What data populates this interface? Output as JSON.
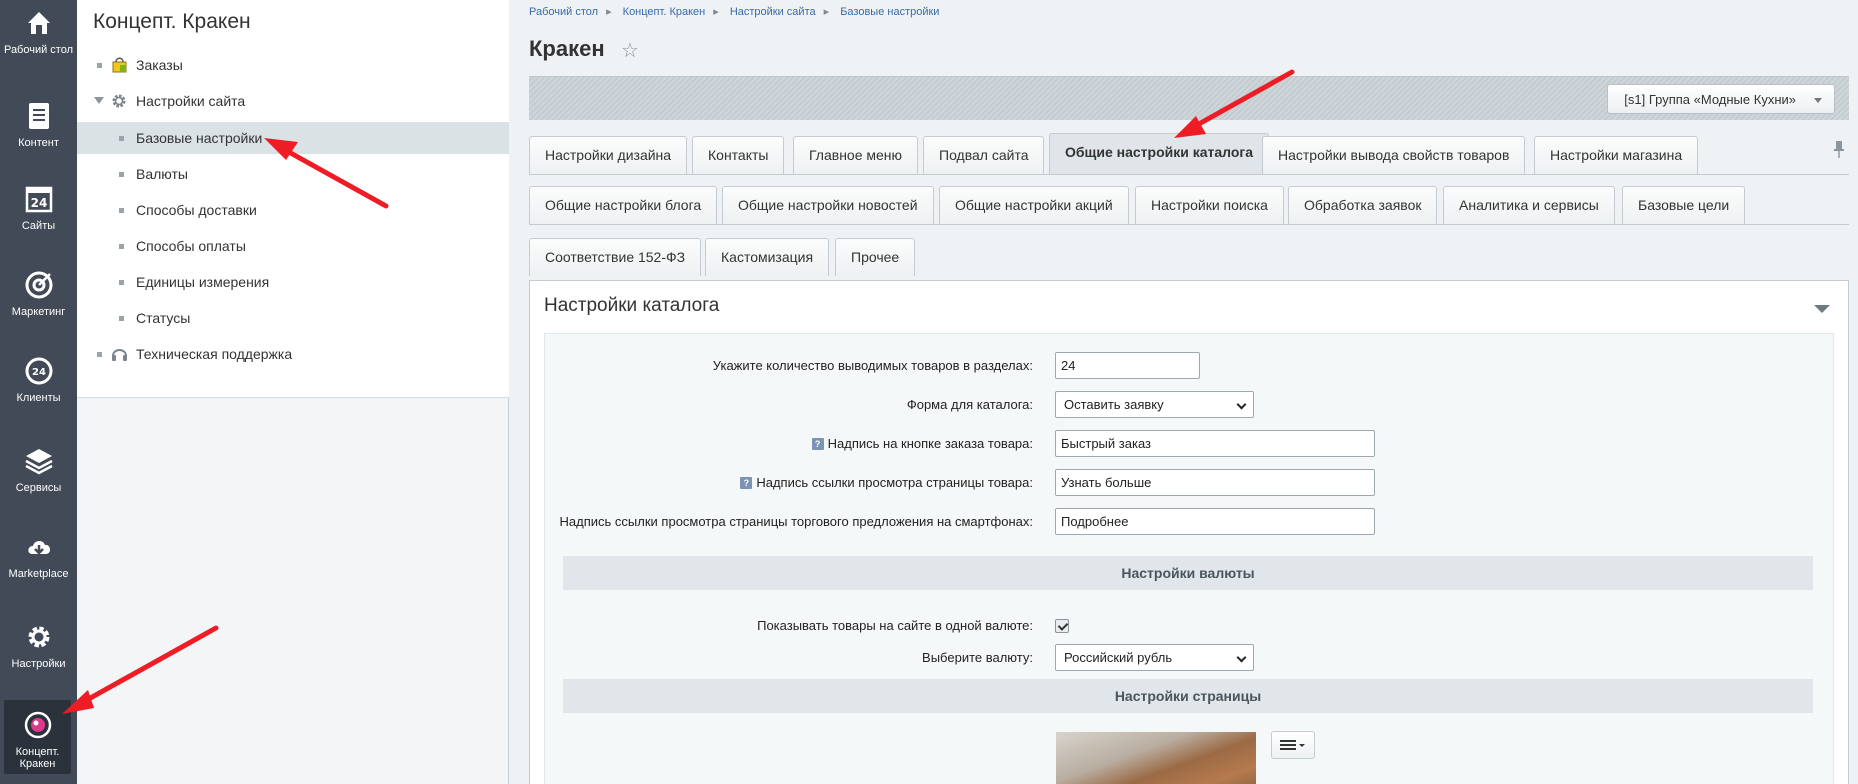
{
  "rail": [
    {
      "label": "Рабочий стол",
      "icon": "home-icon"
    },
    {
      "label": "Контент",
      "icon": "document-icon"
    },
    {
      "label": "Сайты",
      "icon": "calendar-24-icon"
    },
    {
      "label": "Маркетинг",
      "icon": "target-icon"
    },
    {
      "label": "Клиенты",
      "icon": "crm-24-icon"
    },
    {
      "label": "Сервисы",
      "icon": "layers-icon"
    },
    {
      "label": "Marketplace",
      "icon": "cloud-download-icon"
    },
    {
      "label": "Настройки",
      "icon": "gear-icon"
    },
    {
      "label": "Концепт. Кракен",
      "icon": "kraken-logo-icon"
    }
  ],
  "menu": {
    "title": "Концепт. Кракен",
    "items": [
      {
        "label": "Заказы",
        "icon": "shopping-bag-icon"
      },
      {
        "label": "Настройки сайта",
        "icon": "gear-icon"
      },
      {
        "label": "Базовые настройки"
      },
      {
        "label": "Валюты"
      },
      {
        "label": "Способы доставки"
      },
      {
        "label": "Способы оплаты"
      },
      {
        "label": "Единицы измерения"
      },
      {
        "label": "Статусы"
      },
      {
        "label": "Техническая поддержка",
        "icon": "headset-icon"
      }
    ]
  },
  "breadcrumbs": [
    "Рабочий стол",
    "Концепт. Кракен",
    "Настройки сайта",
    "Базовые настройки"
  ],
  "page_title": "Кракен",
  "site_selector": "[s1] Группа «Модные Кухни»",
  "tabs_row1": [
    "Настройки дизайна",
    "Контакты",
    "Главное меню",
    "Подвал сайта",
    "Общие настройки каталога",
    "Настройки вывода свойств товаров",
    "Настройки магазина"
  ],
  "tabs_row2": [
    "Общие настройки блога",
    "Общие настройки новостей",
    "Общие настройки акций",
    "Настройки поиска",
    "Обработка заявок",
    "Аналитика и сервисы",
    "Базовые цели"
  ],
  "tabs_row3": [
    "Соответствие 152-ФЗ",
    "Кастомизация",
    "Прочее"
  ],
  "active_tab": "Общие настройки каталога",
  "panel": {
    "title": "Настройки каталога",
    "fields": [
      {
        "label": "Укажите количество выводимых товаров в разделах:",
        "value": "24"
      },
      {
        "label": "Форма для каталога:",
        "value": "Оставить заявку"
      },
      {
        "label": "Надпись на кнопке заказа товара:",
        "value": "Быстрый заказ",
        "help": "?"
      },
      {
        "label": "Надпись ссылки просмотра страницы товара:",
        "value": "Узнать больше",
        "help": "?"
      },
      {
        "label": "Надпись ссылки просмотра страницы торгового предложения на смартфонах:",
        "value": "Подробнее"
      }
    ],
    "currency_section": "Настройки валюты",
    "currency_fields": [
      {
        "label": "Показывать товары на сайте в одной валюте:",
        "checked": true
      },
      {
        "label": "Выберите валюту:",
        "value": "Российский рубль"
      }
    ],
    "page_section": "Настройки страницы"
  },
  "colors": {
    "annotation_arrow": "#ee1c25",
    "rail_bg": "#414a56"
  }
}
